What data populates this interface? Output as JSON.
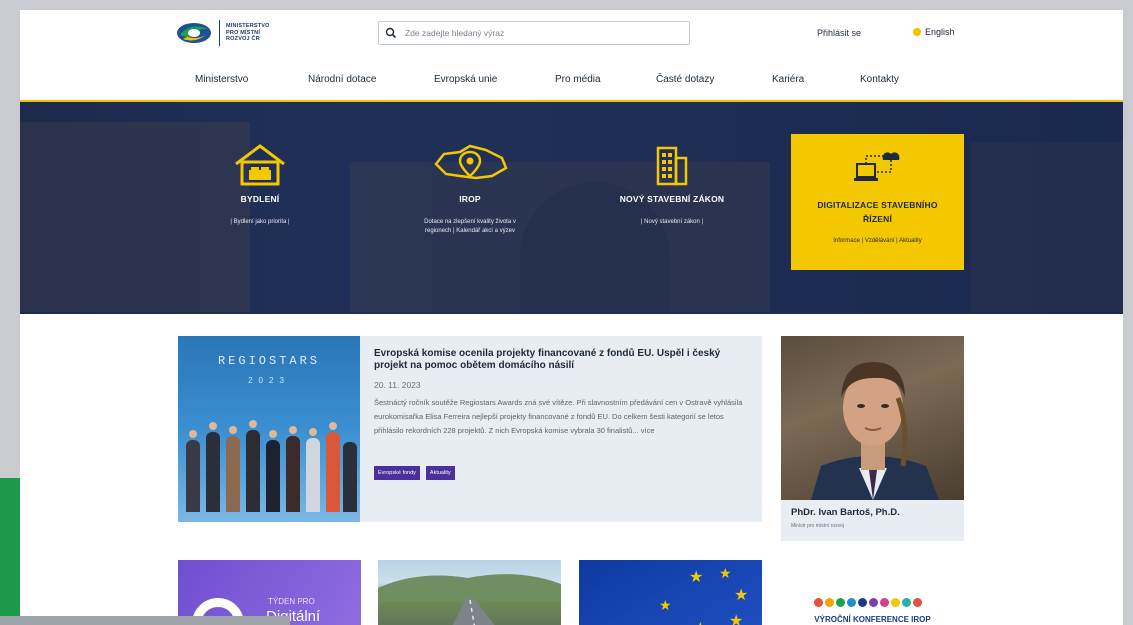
{
  "logo": {
    "line1": "MINISTERSTVO",
    "line2": "PRO MÍSTNÍ",
    "line3": "ROZVOJ ČR"
  },
  "search": {
    "placeholder": "Zde zadejte hledaný výraz"
  },
  "header": {
    "login": "Přihlásit se",
    "language": "English"
  },
  "nav": [
    "Ministerstvo",
    "Národní dotace",
    "Evropská unie",
    "Pro média",
    "Časté dotazy",
    "Kariéra",
    "Kontakty"
  ],
  "hero": {
    "tiles": [
      {
        "title": "BYDLENÍ",
        "sub": "| Bydlení jako priorita |",
        "icon": "house-icon"
      },
      {
        "title": "IROP",
        "sub1": "Dotace na zlepšení kvality života v",
        "sub2": "regionech | Kalendář akcí a výzev",
        "icon": "map-pin-icon"
      },
      {
        "title": "NOVÝ STAVEBNÍ ZÁKON",
        "sub": "| Nový stavební zákon |",
        "icon": "building-icon"
      }
    ],
    "featured": {
      "title1": "DIGITALIZACE STAVEBNÍHO",
      "title2": "ŘÍZENÍ",
      "sub": "Informace | Vzdělávání | Aktuality",
      "icon": "cloud-computer-icon"
    }
  },
  "news": {
    "image_text": "REGIOSTARS",
    "image_year": "2023",
    "title": "Evropská komise ocenila projekty financované z fondů EU. Uspěl i český projekt na pomoc obětem domácího násilí",
    "date": "20. 11. 2023",
    "body": "Šestnáctý ročník soutěže Regiostars Awards zná své vítěze. Při slavnostním předávání cen v Ostravě vyhlásila eurokomisařka Elisa Ferreira nejlepší projekty financované z fondů EU. Do celkem šesti kategorií se letos přihlásilo rekordních 228 projektů. Z nich Evropská komise vybrala 30 finalistů... více",
    "tags": [
      "Evropské fondy",
      "Aktuality"
    ]
  },
  "minister": {
    "name": "PhDr. Ivan Bartoš, Ph.D.",
    "role": "Ministr pro místní rozvoj"
  },
  "cards": {
    "week_label": "TÝDEN PRO",
    "digi_label": "Digitální",
    "conference": "VÝROČNÍ KONFERENCE IROP"
  },
  "colors": {
    "accent_yellow": "#f3c800",
    "navy": "#24365c",
    "tag_purple": "#4b2f9a"
  }
}
